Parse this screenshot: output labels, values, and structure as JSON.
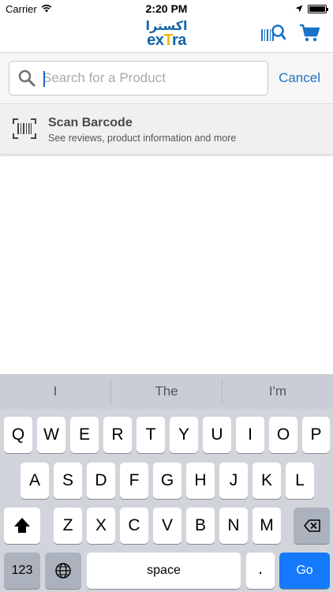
{
  "status_bar": {
    "carrier": "Carrier",
    "time": "2:20 PM"
  },
  "navbar": {
    "logo_arabic": "اكسترا",
    "logo_letters": [
      "ex",
      "T",
      "ra"
    ],
    "accent_color": "#1565a8",
    "logo_yellow": "#f2b705"
  },
  "search": {
    "placeholder": "Search for a Product",
    "value": "",
    "cancel_label": "Cancel",
    "link_color": "#2173c7"
  },
  "scan": {
    "title": "Scan Barcode",
    "subtitle": "See reviews, product information and more"
  },
  "keyboard": {
    "suggestions": [
      "I",
      "The",
      "I'm"
    ],
    "row1": [
      "Q",
      "W",
      "E",
      "R",
      "T",
      "Y",
      "U",
      "I",
      "O",
      "P"
    ],
    "row2": [
      "A",
      "S",
      "D",
      "F",
      "G",
      "H",
      "J",
      "K",
      "L"
    ],
    "row3": [
      "Z",
      "X",
      "C",
      "V",
      "B",
      "N",
      "M"
    ],
    "numbers_label": "123",
    "space_label": "space",
    "period_label": ".",
    "go_label": "Go",
    "go_color": "#1479fb"
  }
}
